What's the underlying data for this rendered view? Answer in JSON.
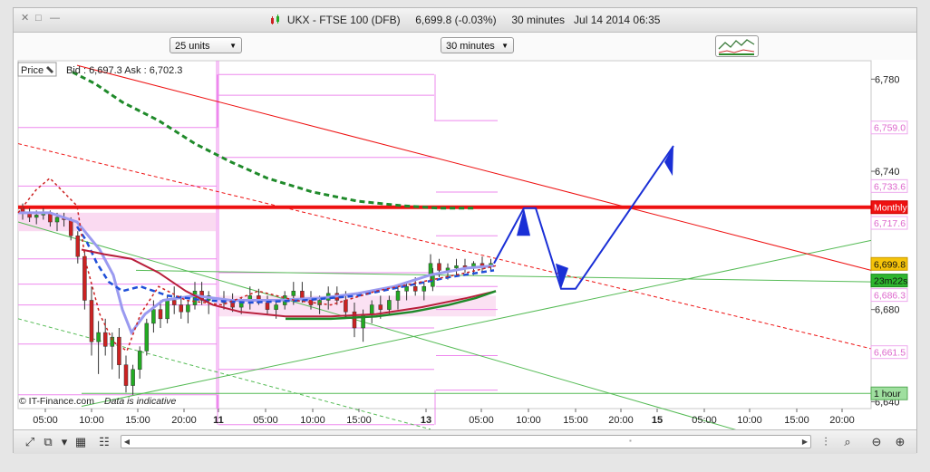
{
  "window": {
    "title": "UKX - FTSE 100 (DFB)",
    "price_info": "6,699.8 (-0.03%)",
    "interval_info": "30 minutes",
    "datetime": "Jul 14 2014 06:35"
  },
  "toolbar": {
    "units_select": "25 units",
    "interval_select": "30 minutes"
  },
  "chart_header": {
    "price_label": "Price",
    "bid_ask": "Bid : 6,697.3 Ask : 6,702.3"
  },
  "footer": {
    "copyright": "© IT-Finance.com",
    "disclaimer": "Data is indicative"
  },
  "colors": {
    "up_candle": "#22aa22",
    "down_candle": "#cc2222",
    "resistance_line": "#ee1111",
    "trend_arrow": "#1a2fd6",
    "pivot_lines": "#ee88ee",
    "support_lines": "#55bb55",
    "sma_green": "#1f8a2a",
    "sma_red": "#b81e3a",
    "ma_blue": "#1f4fd8",
    "ma_lavender": "#9a9af0"
  },
  "chart_data": {
    "type": "candlestick",
    "symbol": "UKX - FTSE 100 (DFB)",
    "ylim": [
      6637,
      6788
    ],
    "y_ticks": [
      6640,
      6680,
      6700,
      6740,
      6780
    ],
    "y_tick_labels": [
      "6,640",
      "6,680",
      "6,700",
      "6,740",
      "6,780"
    ],
    "x_tick_labels": [
      "05:00",
      "10:00",
      "15:00",
      "20:00",
      "11",
      "05:00",
      "10:00",
      "15:00",
      "13",
      "05:00",
      "10:00",
      "15:00",
      "20:00",
      "15",
      "05:00",
      "10:00",
      "15:00",
      "20:00"
    ],
    "right_labels": [
      {
        "text": "6,759.0",
        "value": 6759.0,
        "style": "pivot"
      },
      {
        "text": "6,733.6",
        "value": 6733.6,
        "style": "pivot"
      },
      {
        "text": "Monthly",
        "value": 6724.4,
        "style": "monthly"
      },
      {
        "text": "6,717.6",
        "value": 6717.6,
        "style": "pivot"
      },
      {
        "text": "6,699.8",
        "value": 6699.8,
        "style": "price"
      },
      {
        "text": "23m22s",
        "value": 6692.6,
        "style": "timer"
      },
      {
        "text": "6,686.3",
        "value": 6686.3,
        "style": "pivot"
      },
      {
        "text": "6,661.5",
        "value": 6661.5,
        "style": "pivot"
      },
      {
        "text": "1 hour",
        "value": 6643.6,
        "style": "hour"
      }
    ],
    "monthly_level": 6724.4,
    "last_price": 6699.8,
    "hour_level": 6643.6,
    "candles_day1": [
      [
        6724,
        6726,
        6719,
        6722
      ],
      [
        6722,
        6724,
        6718,
        6720
      ],
      [
        6720,
        6723,
        6717,
        6721
      ],
      [
        6721,
        6724,
        6719,
        6722
      ],
      [
        6722,
        6723,
        6716,
        6718
      ],
      [
        6718,
        6722,
        6714,
        6720
      ],
      [
        6720,
        6722,
        6716,
        6719
      ],
      [
        6719,
        6720,
        6710,
        6712
      ],
      [
        6712,
        6714,
        6700,
        6703
      ],
      [
        6703,
        6706,
        6680,
        6684
      ],
      [
        6684,
        6690,
        6660,
        6666
      ],
      [
        6666,
        6675,
        6652,
        6670
      ],
      [
        6670,
        6676,
        6660,
        6664
      ],
      [
        6664,
        6670,
        6654,
        6668
      ],
      [
        6668,
        6672,
        6650,
        6656
      ],
      [
        6656,
        6660,
        6644,
        6647
      ],
      [
        6647,
        6656,
        6643,
        6654
      ],
      [
        6654,
        6664,
        6650,
        6662
      ],
      [
        6662,
        6676,
        6660,
        6674
      ],
      [
        6674,
        6684,
        6670,
        6680
      ],
      [
        6680,
        6684,
        6672,
        6676
      ],
      [
        6676,
        6686,
        6674,
        6684
      ],
      [
        6684,
        6690,
        6678,
        6682
      ],
      [
        6682,
        6686,
        6676,
        6679
      ],
      [
        6679,
        6684,
        6674,
        6682
      ],
      [
        6682,
        6692,
        6680,
        6688
      ],
      [
        6688,
        6692,
        6682,
        6684
      ],
      [
        6684,
        6688,
        6678,
        6686
      ]
    ],
    "candles_day2": [
      [
        6684,
        6688,
        6680,
        6683
      ],
      [
        6683,
        6687,
        6679,
        6681
      ],
      [
        6681,
        6685,
        6678,
        6684
      ],
      [
        6684,
        6690,
        6680,
        6686
      ],
      [
        6686,
        6689,
        6682,
        6683
      ],
      [
        6683,
        6686,
        6678,
        6680
      ],
      [
        6680,
        6684,
        6676,
        6682
      ],
      [
        6682,
        6688,
        6680,
        6686
      ],
      [
        6686,
        6692,
        6682,
        6688
      ],
      [
        6688,
        6692,
        6683,
        6685
      ],
      [
        6685,
        6688,
        6680,
        6682
      ],
      [
        6682,
        6686,
        6678,
        6684
      ],
      [
        6684,
        6690,
        6680,
        6687
      ],
      [
        6687,
        6690,
        6682,
        6684
      ],
      [
        6684,
        6688,
        6676,
        6679
      ],
      [
        6679,
        6683,
        6668,
        6672
      ],
      [
        6672,
        6680,
        6666,
        6678
      ],
      [
        6678,
        6684,
        6674,
        6682
      ],
      [
        6682,
        6686,
        6676,
        6680
      ],
      [
        6680,
        6686,
        6678,
        6684
      ],
      [
        6684,
        6690,
        6680,
        6688
      ],
      [
        6688,
        6692,
        6684,
        6690
      ],
      [
        6690,
        6694,
        6686,
        6688
      ],
      [
        6688,
        6692,
        6684,
        6690
      ],
      [
        6690,
        6698,
        6688,
        6695
      ]
    ],
    "candles_day3": [
      [
        6695,
        6704,
        6692,
        6700
      ],
      [
        6700,
        6702,
        6694,
        6697
      ],
      [
        6697,
        6700,
        6693,
        6698
      ],
      [
        6698,
        6702,
        6695,
        6699
      ],
      [
        6699,
        6702,
        6696,
        6698
      ],
      [
        6698,
        6701,
        6695,
        6700
      ],
      [
        6700,
        6703,
        6696,
        6699
      ],
      [
        6699,
        6702,
        6697,
        6700
      ]
    ]
  }
}
